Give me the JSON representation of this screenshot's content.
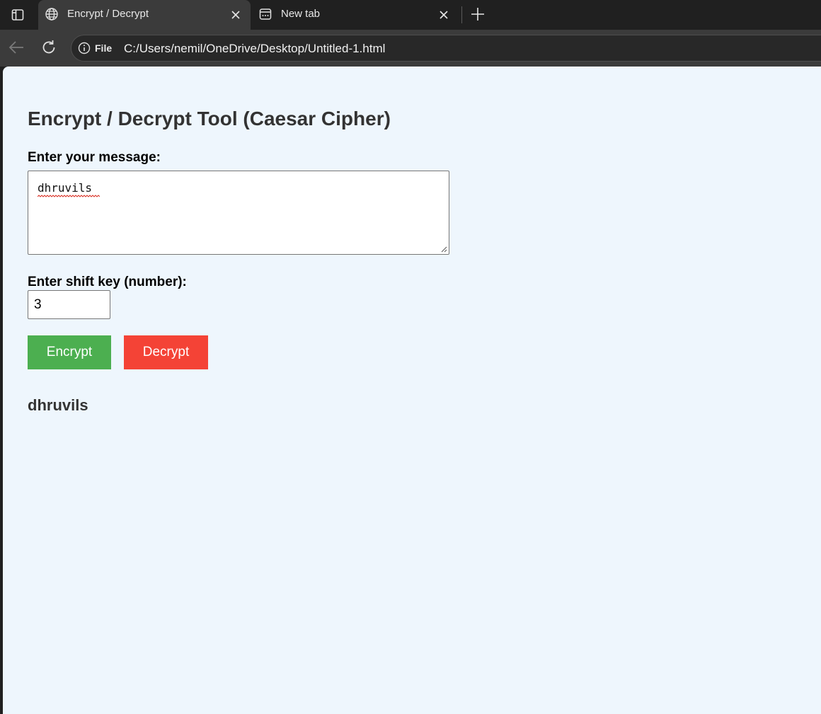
{
  "browser": {
    "tabs": [
      {
        "title": "Encrypt / Decrypt",
        "icon": "globe-icon",
        "active": true
      },
      {
        "title": "New tab",
        "icon": "new-tab-page-icon",
        "active": false
      }
    ],
    "site_info_label": "File",
    "url": "C:/Users/nemil/OneDrive/Desktop/Untitled-1.html"
  },
  "page": {
    "title": "Encrypt / Decrypt Tool (Caesar Cipher)",
    "message_label": "Enter your message:",
    "message_value": "dhruvils",
    "shift_label": "Enter shift key (number):",
    "shift_value": "3",
    "encrypt_label": "Encrypt",
    "decrypt_label": "Decrypt",
    "result": "dhruvils"
  },
  "colors": {
    "page_background": "#eef6fd",
    "encrypt_button": "#4caf50",
    "decrypt_button": "#f44336",
    "heading_text": "#333333"
  }
}
